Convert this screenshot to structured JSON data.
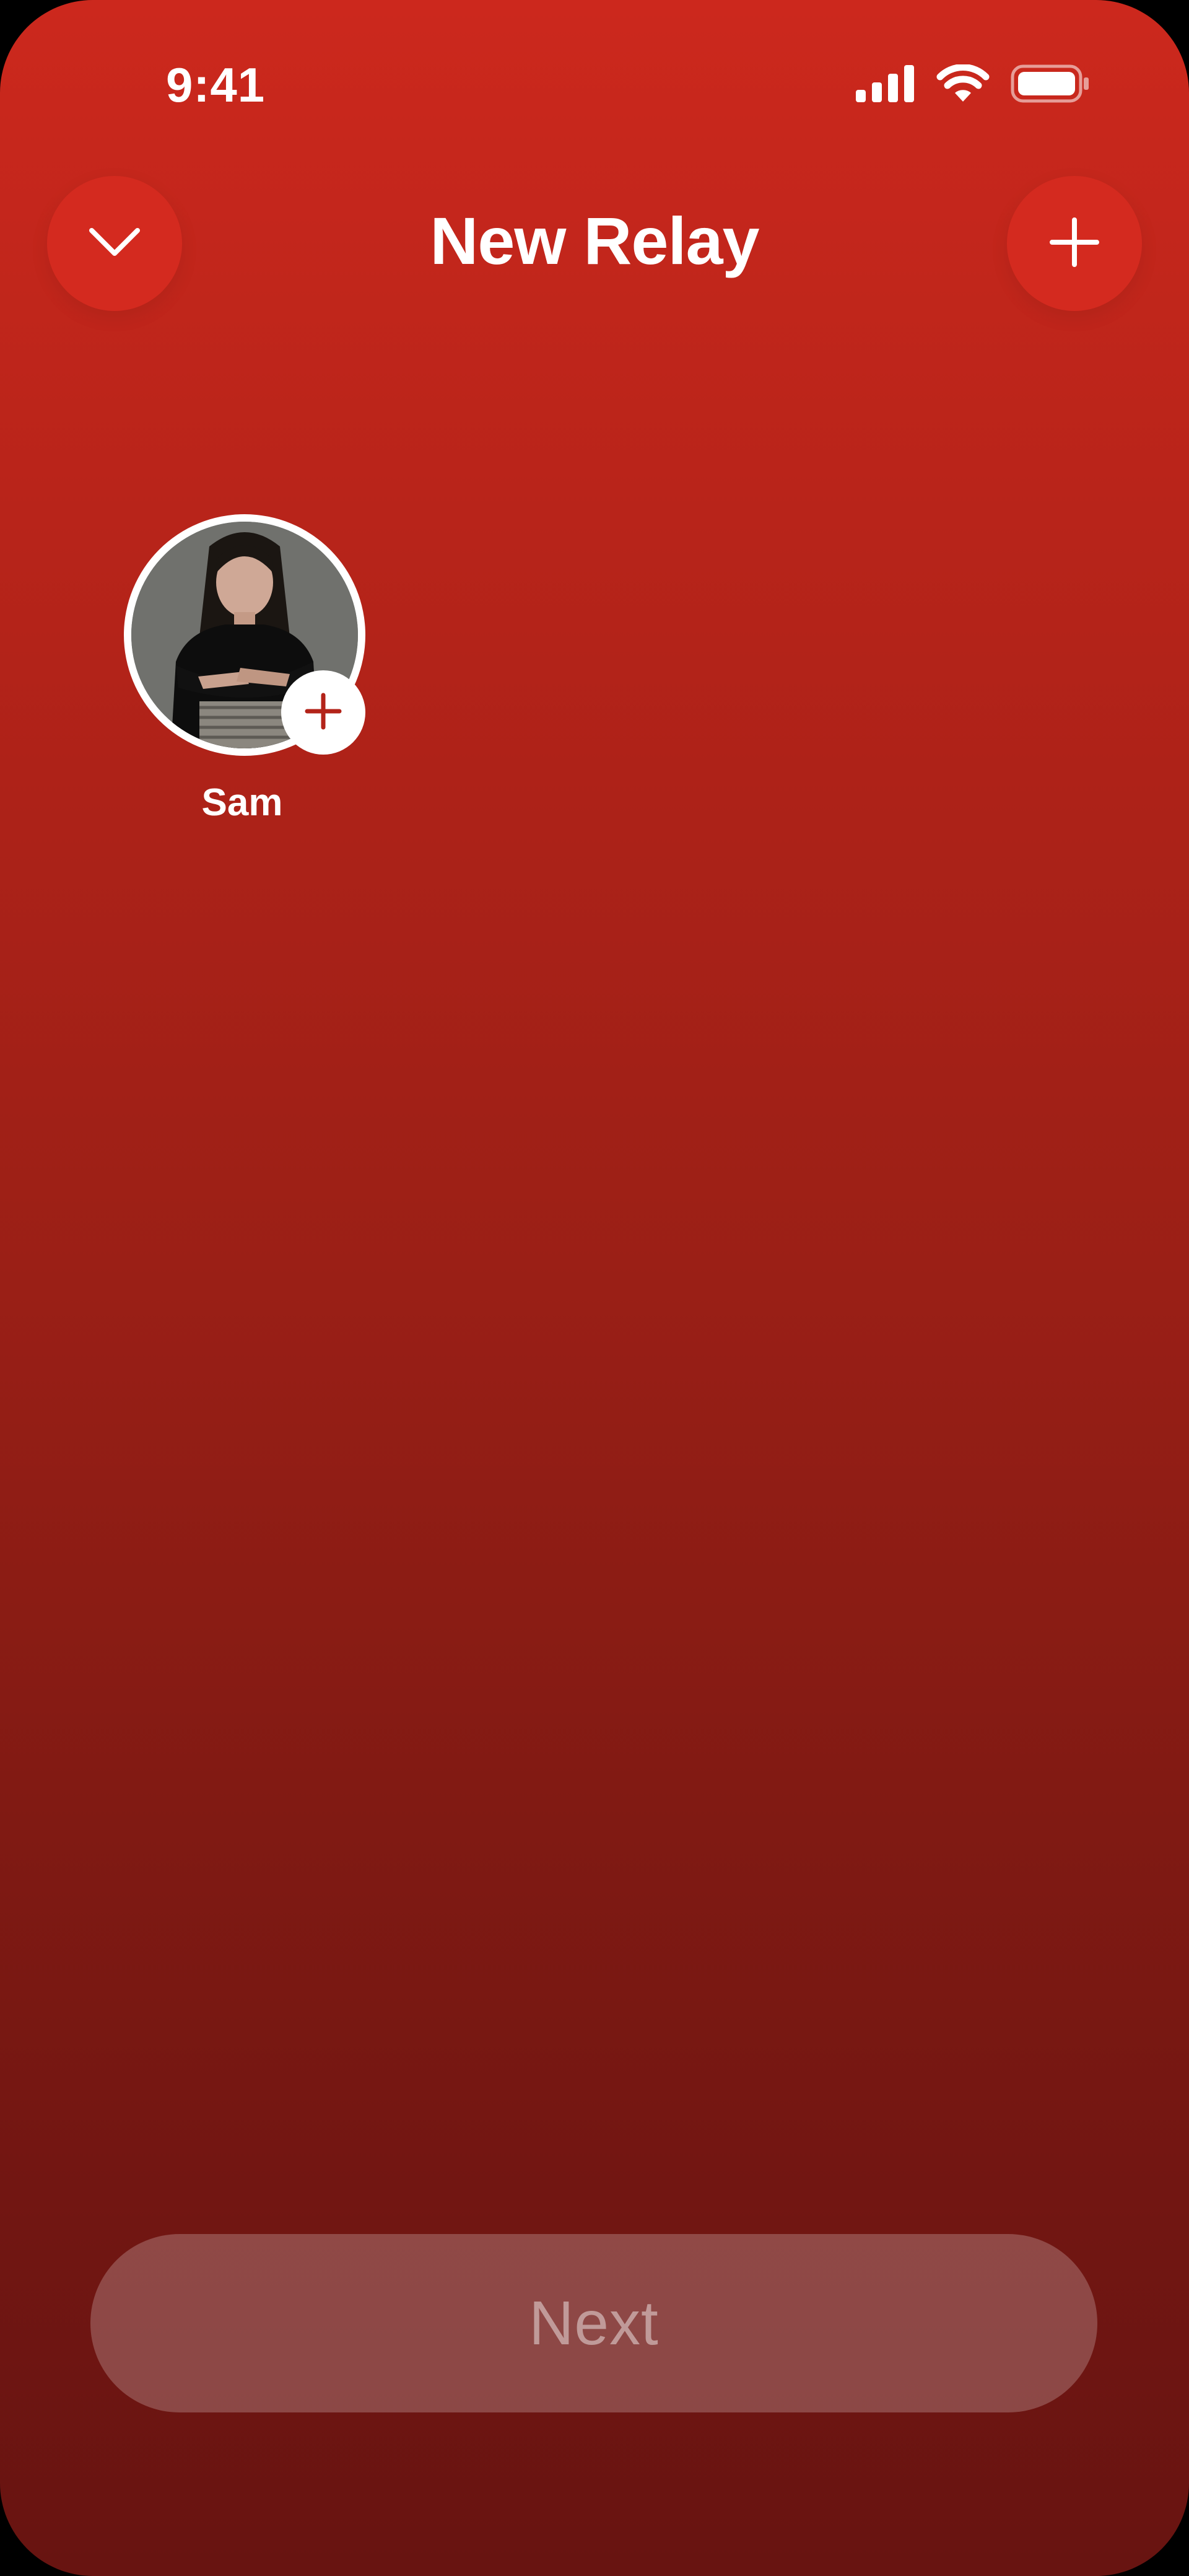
{
  "status_bar": {
    "time": "9:41",
    "icons": [
      "signal-icon",
      "wifi-icon",
      "battery-icon"
    ]
  },
  "header": {
    "title": "New Relay",
    "left_button_icon": "chevron-down-icon",
    "right_button_icon": "plus-icon"
  },
  "contacts": [
    {
      "name": "Sam",
      "badge_icon": "plus-icon"
    }
  ],
  "footer": {
    "next_label": "Next"
  },
  "colors": {
    "background_top": "#cc281d",
    "background_bottom": "#681411",
    "button_red": "#d42a1f",
    "text": "#ffffff"
  }
}
